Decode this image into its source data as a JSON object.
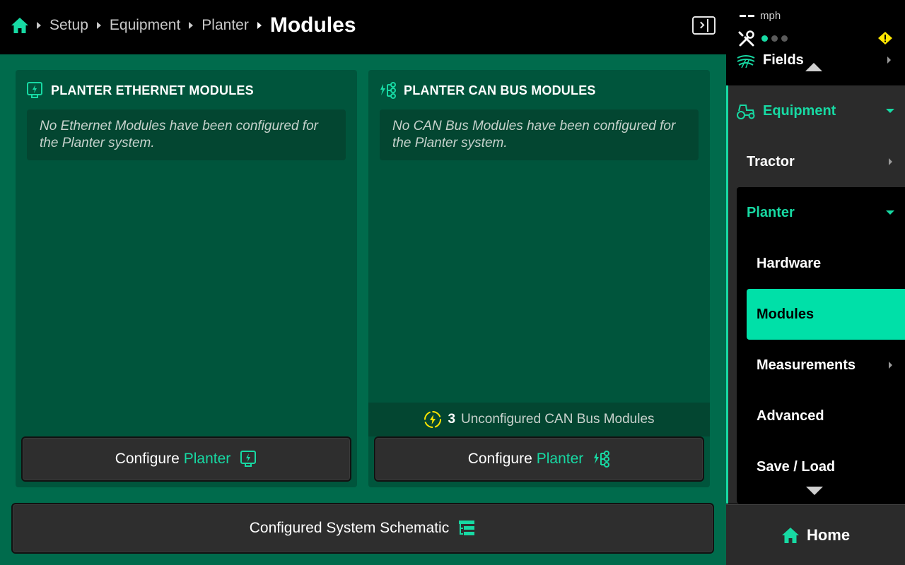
{
  "breadcrumb": {
    "items": [
      "Setup",
      "Equipment",
      "Planter"
    ],
    "current": "Modules"
  },
  "ethernet_card": {
    "title": "PLANTER ETHERNET MODULES",
    "empty_message": "No Ethernet Modules have been configured for the Planter system.",
    "button_text": "Configure",
    "button_accent": "Planter"
  },
  "canbus_card": {
    "title": "PLANTER CAN BUS MODULES",
    "empty_message": "No CAN Bus Modules have been configured for the Planter system.",
    "unconfigured_count": "3",
    "unconfigured_label": "Unconfigured CAN Bus Modules",
    "button_text": "Configure",
    "button_accent": "Planter"
  },
  "schematic_button": "Configured System Schematic",
  "status": {
    "speed_unit": "mph",
    "dots_active": 1,
    "dots_total": 3
  },
  "sidebar": {
    "fields": "Fields",
    "equipment": "Equipment",
    "tractor": "Tractor",
    "planter": "Planter",
    "children": [
      "Hardware",
      "Modules",
      "Measurements",
      "Advanced",
      "Save / Load"
    ],
    "active_child": "Modules",
    "home": "Home"
  },
  "colors": {
    "accent": "#17d9a3",
    "main_bg": "#006b4c",
    "card_bg": "#00553c",
    "warning": "#ffe600"
  }
}
